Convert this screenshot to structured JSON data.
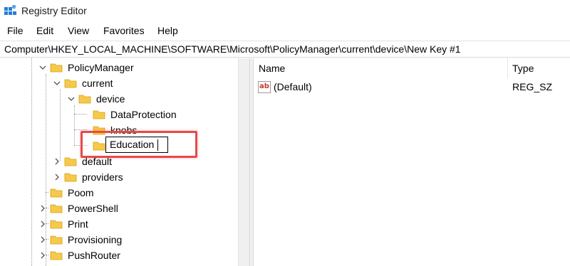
{
  "window": {
    "title": "Registry Editor",
    "app_icon": "regedit-icon"
  },
  "menu": [
    "File",
    "Edit",
    "View",
    "Favorites",
    "Help"
  ],
  "address": "Computer\\HKEY_LOCAL_MACHINE\\SOFTWARE\\Microsoft\\PolicyManager\\current\\device\\New Key #1",
  "tree": {
    "policymanager": "PolicyManager",
    "current": "current",
    "device": "device",
    "dataprotection": "DataProtection",
    "knobs": "knobs",
    "rename_value": "Education",
    "default": "default",
    "providers": "providers",
    "poom": "Poom",
    "powershell": "PowerShell",
    "print": "Print",
    "provisioning": "Provisioning",
    "pushrouter": "PushRouter"
  },
  "list": {
    "headers": {
      "name": "Name",
      "type": "Type"
    },
    "rows": [
      {
        "name": "(Default)",
        "type": "REG_SZ",
        "icon": "string-value-icon"
      }
    ]
  },
  "colors": {
    "highlight": "#e64a4a",
    "folder": "#f7c948"
  }
}
